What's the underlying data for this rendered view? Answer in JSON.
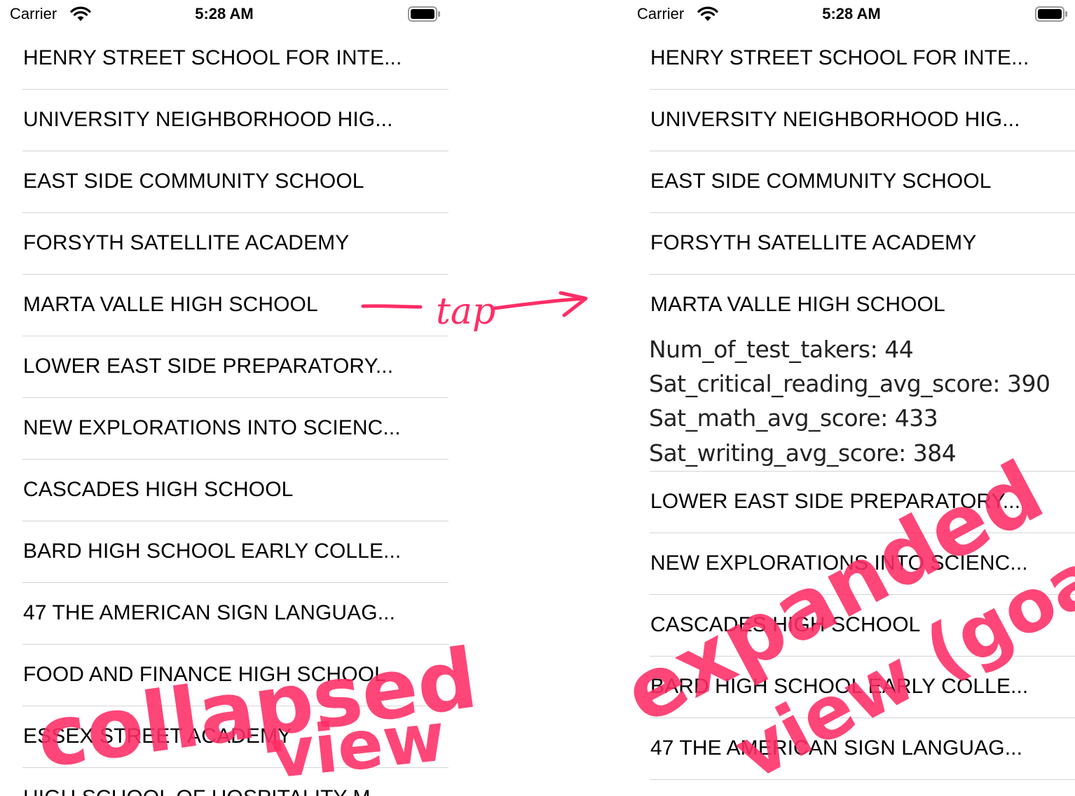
{
  "status_bar": {
    "carrier": "Carrier",
    "time": "5:28 AM"
  },
  "left_list": [
    "HENRY STREET SCHOOL FOR INTE...",
    "UNIVERSITY NEIGHBORHOOD HIG...",
    "EAST SIDE COMMUNITY SCHOOL",
    "FORSYTH SATELLITE ACADEMY",
    "MARTA VALLE HIGH SCHOOL",
    "LOWER EAST SIDE PREPARATORY...",
    "NEW EXPLORATIONS INTO SCIENC...",
    "CASCADES HIGH SCHOOL",
    "BARD HIGH SCHOOL EARLY COLLE...",
    "47 THE AMERICAN SIGN LANGUAG...",
    "FOOD AND FINANCE HIGH SCHOOL",
    "ESSEX STREET ACADEMY",
    "HIGH SCHOOL OF HOSPITALITY M..."
  ],
  "right_list_before": [
    "HENRY STREET SCHOOL FOR INTE...",
    "UNIVERSITY NEIGHBORHOOD HIG...",
    "EAST SIDE COMMUNITY SCHOOL",
    "FORSYTH SATELLITE ACADEMY",
    "MARTA VALLE HIGH SCHOOL"
  ],
  "expanded_details": [
    "Num_of_test_takers: 44",
    "Sat_critical_reading_avg_score: 390",
    "Sat_math_avg_score: 433",
    "Sat_writing_avg_score: 384"
  ],
  "right_list_after": [
    "LOWER EAST SIDE PREPARATORY...",
    "NEW EXPLORATIONS INTO SCIENC...",
    "CASCADES HIGH SCHOOL",
    "BARD HIGH SCHOOL EARLY COLLE...",
    "47 THE AMERICAN SIGN LANGUAG..."
  ],
  "annotations": {
    "tap": "tap",
    "collapsed": "collapsed view",
    "expanded": "expanded view (goal)",
    "color": "#ff2d66"
  },
  "colors": {
    "separator": "#d5d5d8",
    "background": "#ffffff"
  },
  "icons": [
    "wifi-icon",
    "battery-icon"
  ]
}
